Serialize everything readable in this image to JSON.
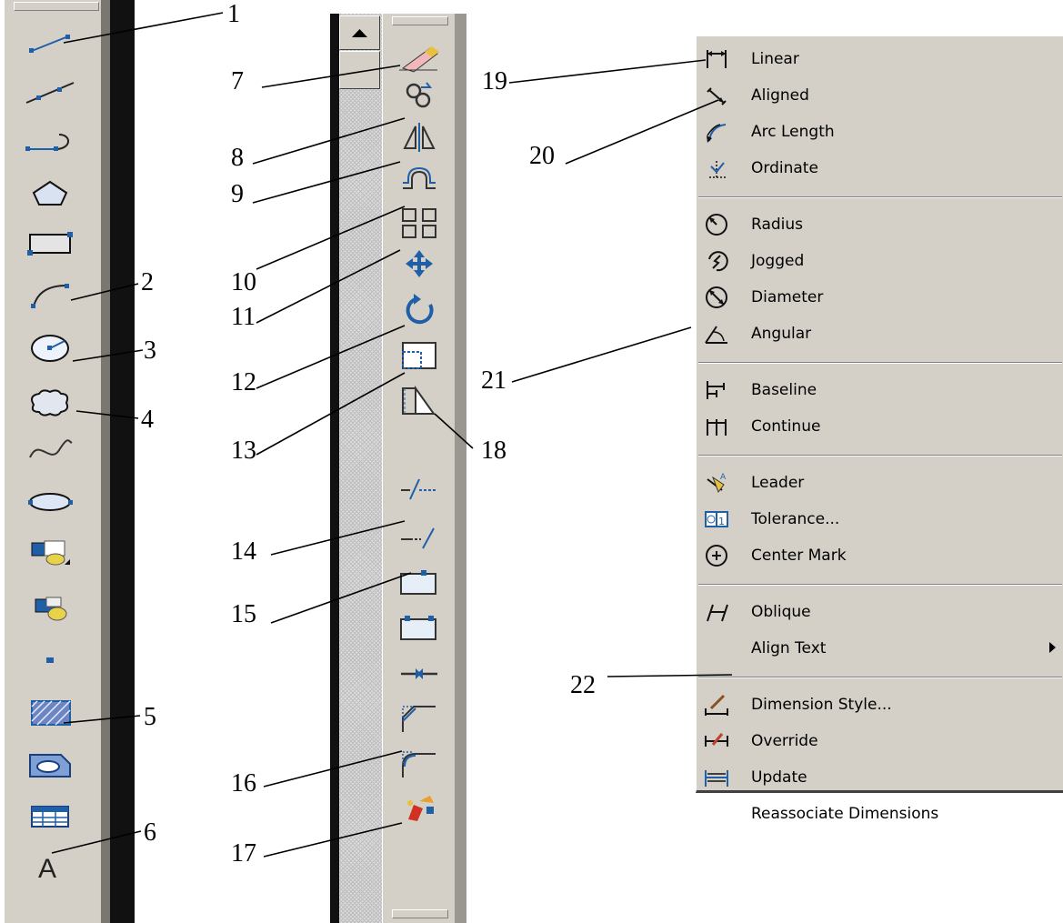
{
  "callouts": [
    "1",
    "2",
    "3",
    "4",
    "5",
    "6",
    "7",
    "8",
    "9",
    "10",
    "11",
    "12",
    "13",
    "14",
    "15",
    "16",
    "17",
    "18",
    "19",
    "20",
    "21",
    "22"
  ],
  "draw_toolbar": {
    "tools": [
      "line-icon",
      "construction-line-icon",
      "polyline-icon",
      "polygon-icon",
      "rectangle-icon",
      "arc-icon",
      "circle-icon",
      "revision-cloud-icon",
      "spline-icon",
      "ellipse-icon",
      "insert-block-icon",
      "make-block-icon",
      "point-icon",
      "hatch-icon",
      "region-icon",
      "table-icon",
      "multiline-text-icon"
    ]
  },
  "modify_toolbar": {
    "tools": [
      "erase-icon",
      "copy-icon",
      "mirror-icon",
      "offset-icon",
      "array-icon",
      "move-icon",
      "rotate-icon",
      "scale-icon",
      "stretch-icon",
      "trim-icon",
      "extend-icon",
      "break-at-point-icon",
      "break-icon",
      "join-icon",
      "chamfer-icon",
      "fillet-icon",
      "explode-icon"
    ]
  },
  "dimension_menu": {
    "groups": [
      [
        {
          "label": "Linear",
          "icon": "linear-dimension-icon"
        },
        {
          "label": "Aligned",
          "icon": "aligned-dimension-icon"
        },
        {
          "label": "Arc Length",
          "icon": "arc-length-icon"
        },
        {
          "label": "Ordinate",
          "icon": "ordinate-icon"
        }
      ],
      [
        {
          "label": "Radius",
          "icon": "radius-icon"
        },
        {
          "label": "Jogged",
          "icon": "jogged-icon"
        },
        {
          "label": "Diameter",
          "icon": "diameter-icon"
        },
        {
          "label": "Angular",
          "icon": "angular-icon"
        }
      ],
      [
        {
          "label": "Baseline",
          "icon": "baseline-icon"
        },
        {
          "label": "Continue",
          "icon": "continue-icon"
        }
      ],
      [
        {
          "label": "Leader",
          "icon": "leader-icon"
        },
        {
          "label": "Tolerance...",
          "icon": "tolerance-icon"
        },
        {
          "label": "Center Mark",
          "icon": "center-mark-icon"
        }
      ],
      [
        {
          "label": "Oblique",
          "icon": "oblique-icon"
        },
        {
          "label": "Align Text",
          "icon": "",
          "submenu": true
        }
      ],
      [
        {
          "label": "Dimension Style...",
          "icon": "dimension-style-icon"
        },
        {
          "label": "Override",
          "icon": "override-icon"
        },
        {
          "label": "Update",
          "icon": "update-icon"
        },
        {
          "label": "Reassociate Dimensions",
          "icon": ""
        }
      ]
    ]
  },
  "colors": {
    "toolbar": "#d4d0c8",
    "icon_blue": "#1f5fa8",
    "menu_text": "#000000"
  }
}
